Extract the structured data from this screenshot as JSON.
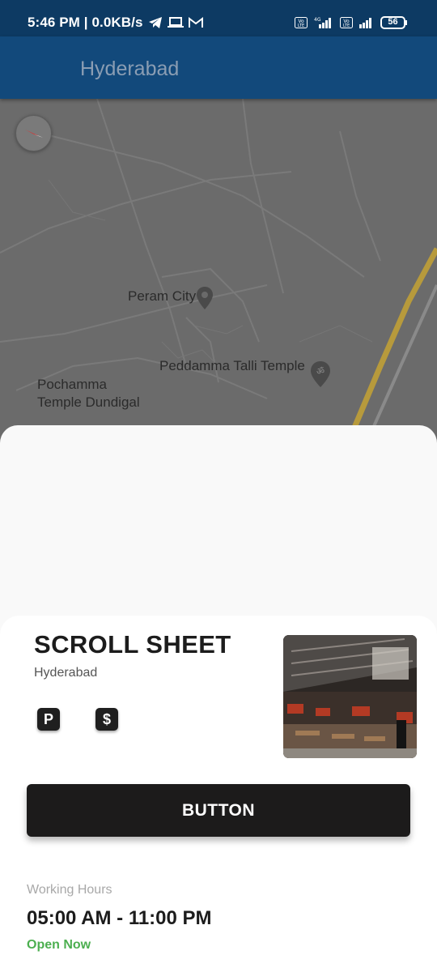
{
  "status_bar": {
    "time_speed": "5:46 PM | 0.0KB/s",
    "network_1": "Vo LTE",
    "network_4g": "4G",
    "network_2": "Vo LTE",
    "battery": "56"
  },
  "app_bar": {
    "title": "Hyderabad"
  },
  "map": {
    "labels": {
      "peram_city": "Peram City",
      "peddamma": "Peddamma Talli Temple",
      "pochamma_line1": "Pochamma",
      "pochamma_line2": "Temple Dundigal"
    }
  },
  "sheet": {
    "title": "SCROLL SHEET",
    "subtitle": "Hyderabad",
    "amenities": [
      "P",
      "$"
    ],
    "button_label": "BUTTON",
    "working_hours_label": "Working Hours",
    "working_hours_value": "05:00 AM - 11:00 PM",
    "open_status": "Open Now",
    "open_color": "#4caf50"
  },
  "colors": {
    "status_bar_bg": "#0d3a63",
    "app_bar_bg": "#12497b",
    "button_bg": "#1c1b1b"
  }
}
